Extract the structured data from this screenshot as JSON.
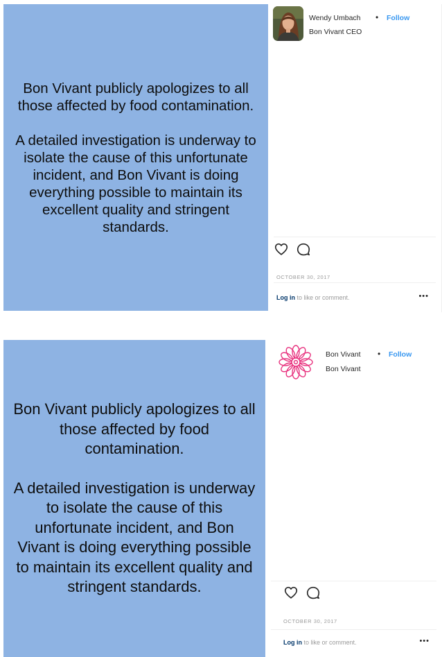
{
  "posts": [
    {
      "caption": {
        "paragraph1": "Bon Vivant publicly apologizes to all those affected by food contamination.",
        "paragraph2": "A detailed investigation is underway to isolate the cause of this unfortunate incident, and Bon Vivant is doing everything possible to maintain its excellent quality and stringent standards."
      },
      "author": {
        "name": "Wendy Umbach",
        "subtitle": "Bon Vivant CEO",
        "avatar_icon": "person-portrait-icon"
      },
      "follow_label": "Follow",
      "dot": "•",
      "date": "OCTOBER 30, 2017",
      "login_link": "Log in",
      "login_rest": " to like or comment.",
      "more_label": "•••"
    },
    {
      "caption": {
        "paragraph1": "Bon Vivant publicly apologizes to all those affected by food contamination.",
        "paragraph2": "A detailed investigation is underway to isolate the cause of this unfortunate incident, and Bon Vivant is doing everything possible to maintain its excellent quality and stringent standards."
      },
      "author": {
        "name": "Bon Vivant",
        "subtitle": "Bon Vivant",
        "avatar_icon": "flower-logo-icon"
      },
      "follow_label": "Follow",
      "dot": "•",
      "date": "OCTOBER 30, 2017",
      "login_link": "Log in",
      "login_rest": " to like or comment.",
      "more_label": "•••"
    }
  ],
  "colors": {
    "panel": "#8eb3e3",
    "follow": "#3897f0",
    "logo": "#e8337f"
  }
}
